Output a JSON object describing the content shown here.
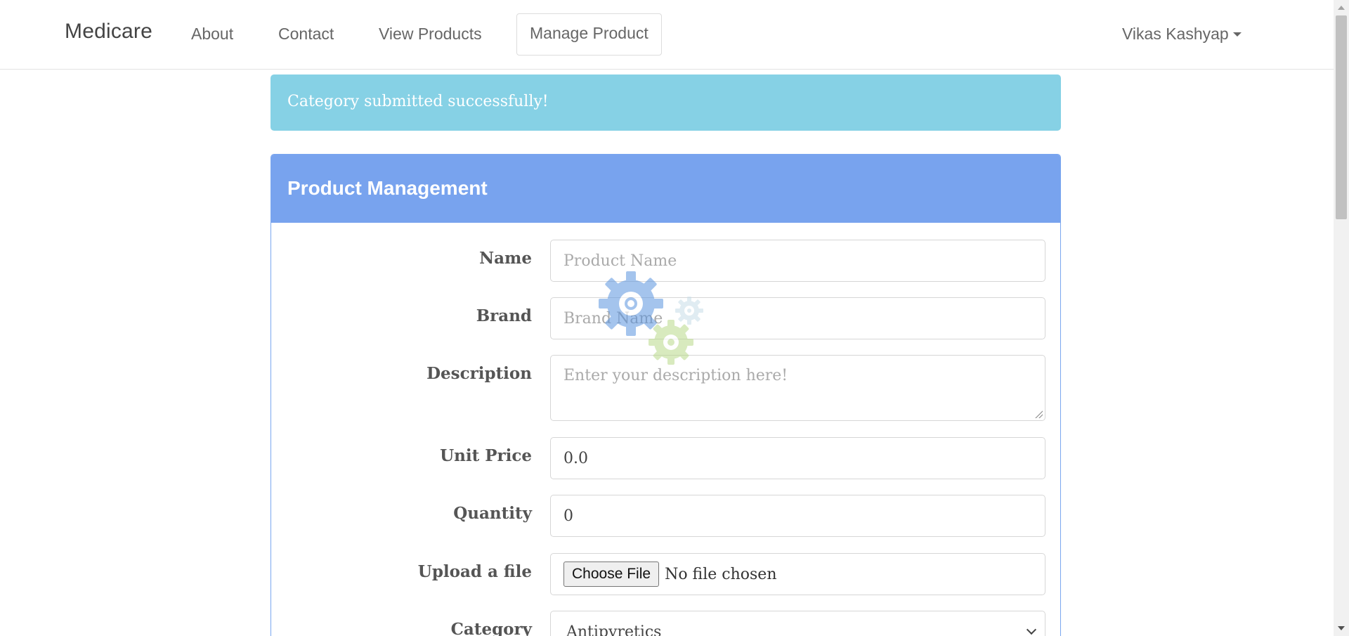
{
  "navbar": {
    "brand": "Medicare",
    "links": [
      {
        "label": "About"
      },
      {
        "label": "Contact"
      },
      {
        "label": "View Products"
      },
      {
        "label": "Manage Product",
        "active": true
      }
    ],
    "user": "Vikas Kashyap"
  },
  "alert": {
    "message": "Category submitted successfully!",
    "color": "#86d1e5"
  },
  "panel": {
    "title": "Product Management",
    "accent": "#78a3ee",
    "fields": {
      "name": {
        "label": "Name",
        "placeholder": "Product Name",
        "value": ""
      },
      "brand": {
        "label": "Brand",
        "placeholder": "Brand Name",
        "value": ""
      },
      "description": {
        "label": "Description",
        "placeholder": "Enter your description here!",
        "value": ""
      },
      "unit_price": {
        "label": "Unit Price",
        "value": "0.0"
      },
      "quantity": {
        "label": "Quantity",
        "value": "0"
      },
      "upload": {
        "label": "Upload a file",
        "button": "Choose File",
        "status": "No file chosen"
      },
      "category": {
        "label": "Category",
        "selected": "Antipyretics"
      }
    }
  },
  "icons": {
    "loading": "gears-loading-icon",
    "dropdown_caret": "caret-down-icon",
    "select_chevron": "chevron-down-icon"
  }
}
